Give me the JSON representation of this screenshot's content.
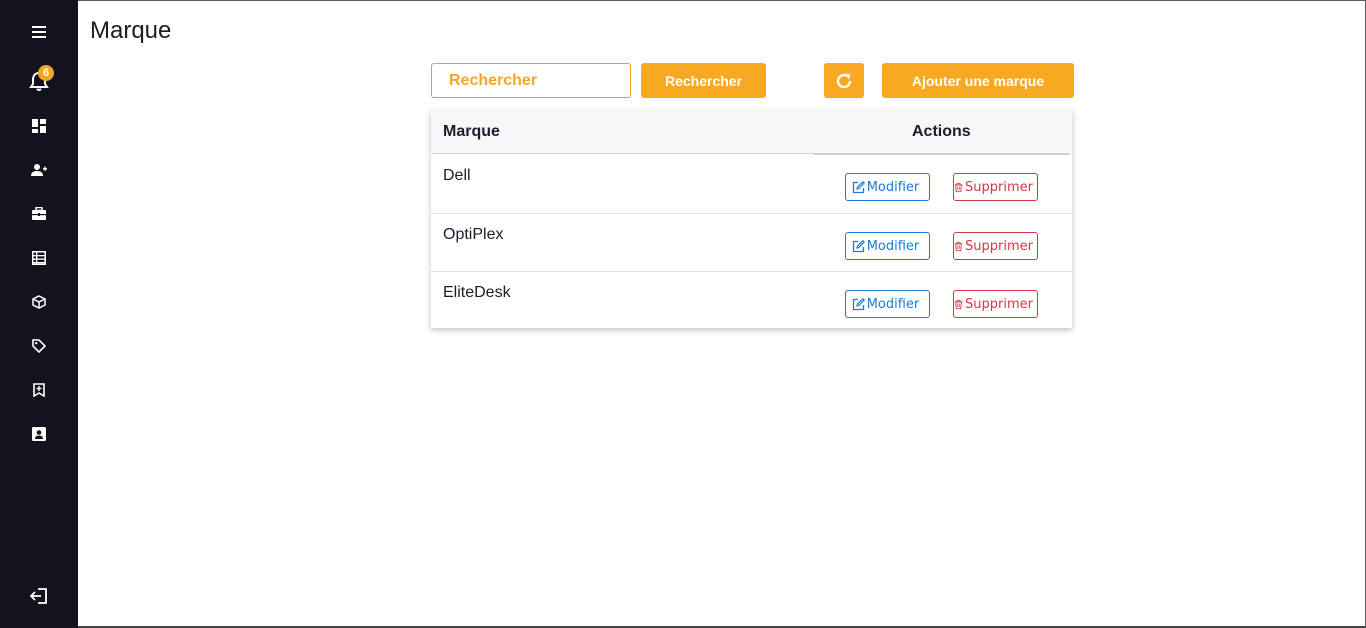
{
  "page": {
    "title": "Marque"
  },
  "notifications": {
    "count": "6"
  },
  "sidebar": {
    "icons": [
      "menu-icon",
      "bell-icon",
      "dashboard-icon",
      "user-add-icon",
      "briefcase-icon",
      "table-icon",
      "cube-icon",
      "tag-icon",
      "bookmark-icon",
      "contact-icon",
      "logout-icon"
    ]
  },
  "toolbar": {
    "search_placeholder": "Rechercher",
    "search_label": "Rechercher",
    "add_label": "Ajouter une marque"
  },
  "table": {
    "headers": {
      "name": "Marque",
      "actions": "Actions"
    },
    "rows": [
      {
        "name": "Dell"
      },
      {
        "name": "OptiPlex"
      },
      {
        "name": "EliteDesk"
      }
    ],
    "edit_label": "Modifier",
    "delete_label": "Supprimer"
  },
  "colors": {
    "sidebar_bg": "#13131f",
    "accent": "#f8a921",
    "edit": "#1e7ad6",
    "delete": "#d6364a"
  }
}
